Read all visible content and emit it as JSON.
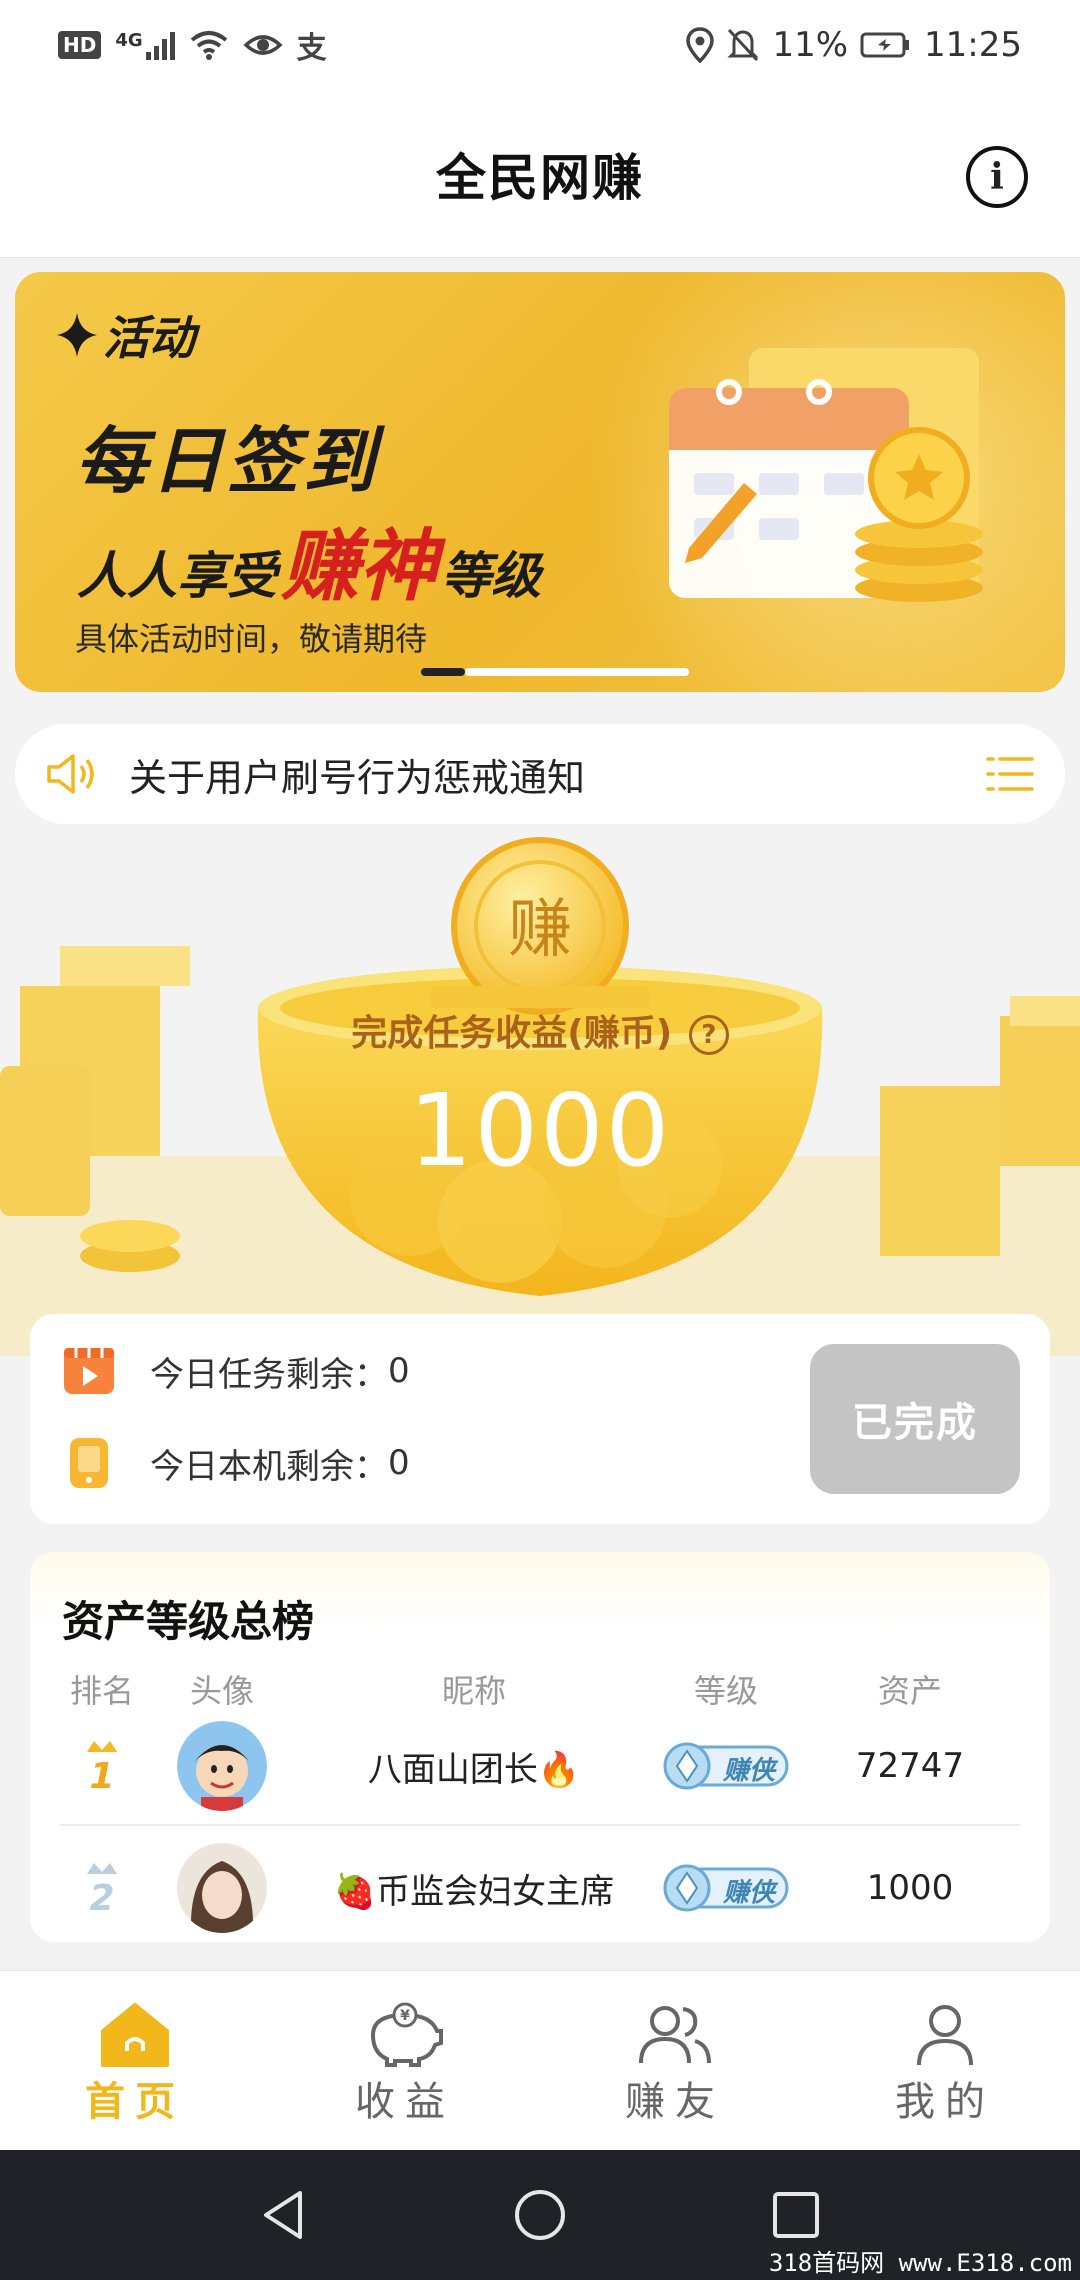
{
  "status_bar": {
    "hd": "HD",
    "network": "4G",
    "battery": "11%",
    "time": "11:25"
  },
  "header": {
    "title": "全民网赚"
  },
  "banner": {
    "tag": "活动",
    "title": "每日签到",
    "subtitle_before": "人人享受",
    "subtitle_highlight": "赚神",
    "subtitle_after": "等级",
    "description": "具体活动时间，敬请期待",
    "page_count": 2,
    "current_page": 1
  },
  "notice": {
    "text": "关于用户刷号行为惩戒通知"
  },
  "earnings": {
    "caption": "完成任务收益(赚币)",
    "value": "1000",
    "coin_char": "赚"
  },
  "tasks": {
    "today_tasks_label": "今日任务剩余：",
    "today_tasks_value": "0",
    "device_label": "今日本机剩余：",
    "device_value": "0",
    "button_label": "已完成"
  },
  "ranking": {
    "title": "资产等级总榜",
    "columns": [
      "排名",
      "头像",
      "昵称",
      "等级",
      "资产"
    ],
    "rows": [
      {
        "rank": "1",
        "nickname": "八面山团长🔥",
        "level": "赚侠",
        "assets": "72747"
      },
      {
        "rank": "2",
        "nickname": "🍓币监会妇女主席",
        "level": "赚侠",
        "assets": "1000"
      }
    ]
  },
  "bottom_nav": [
    {
      "label": "首页",
      "icon": "home-icon",
      "active": true
    },
    {
      "label": "收益",
      "icon": "piggy-bank-icon",
      "active": false
    },
    {
      "label": "赚友",
      "icon": "friends-icon",
      "active": false
    },
    {
      "label": "我的",
      "icon": "profile-icon",
      "active": false
    }
  ],
  "watermark": "318首码网 www.E318.com",
  "colors": {
    "accent": "#f2b81b",
    "banner": "#efb72c",
    "highlight": "#d5201d",
    "done_button": "#c4c4c4"
  }
}
